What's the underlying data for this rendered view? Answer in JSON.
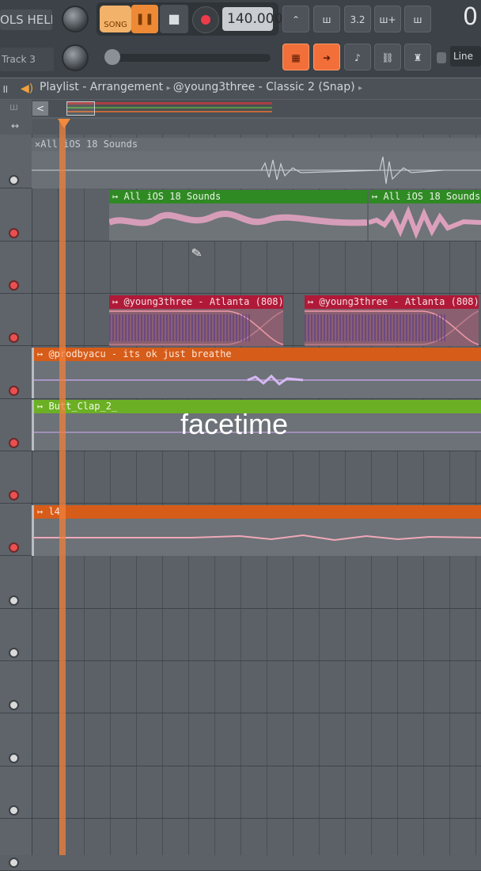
{
  "menu": {
    "tools_help": "OLS HELP"
  },
  "transport": {
    "song_label": "SONG",
    "pause_icon": "pause-icon",
    "stop_icon": "stop-icon",
    "tempo": "140.000"
  },
  "toolbar": {
    "buttons": [
      "ꟷ",
      "ш",
      "3.2",
      "ш+",
      "ш"
    ],
    "big_counter": "0",
    "track_label": "Track 3",
    "line_mode": "Line"
  },
  "playlist": {
    "title": "Playlist - Arrangement",
    "pattern": "@young3three - Classic 2 (Snap)"
  },
  "tracks": [
    {
      "clips": [
        {
          "label": "All iOS 18 Sounds",
          "color": "#6a7075"
        }
      ]
    },
    {
      "clips": [
        {
          "label": "All iOS 18 Sounds",
          "color": "#2f8a24"
        },
        {
          "label": "All iOS 18 Sounds",
          "color": "#2f8a24"
        }
      ]
    },
    {
      "clips": []
    },
    {
      "clips": [
        {
          "label": "@young3three - Atlanta (808)",
          "color": "#b01a38"
        },
        {
          "label": "@young3three - Atlanta (808)",
          "color": "#b01a38"
        }
      ]
    },
    {
      "clips": [
        {
          "label": "@prodbyacu - its ok just breathe",
          "color": "#d65c1a"
        }
      ]
    },
    {
      "clips": [
        {
          "label": "Butt_Clap_2_",
          "color": "#6bb024"
        }
      ]
    },
    {
      "clips": []
    },
    {
      "clips": [
        {
          "label": "l4",
          "color": "#d65c1a"
        }
      ]
    }
  ],
  "overlay": {
    "text": "facetime"
  }
}
